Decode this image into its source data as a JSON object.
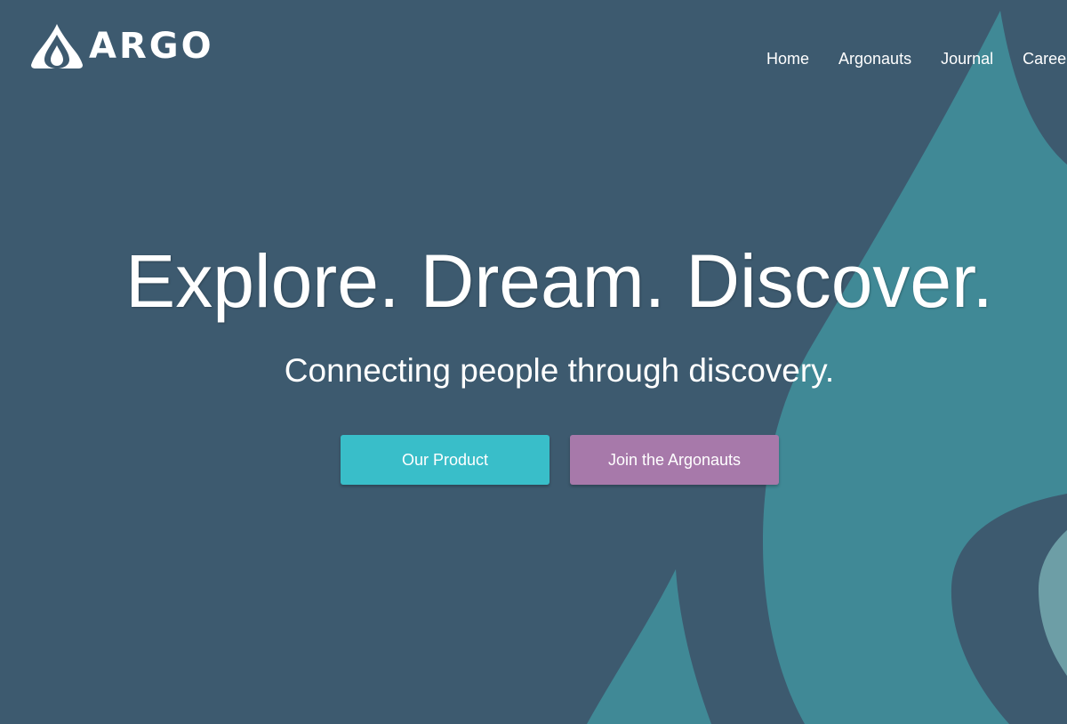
{
  "brand": {
    "name": "ARGO",
    "logo_icon": "water-drop-icon"
  },
  "nav": {
    "items": [
      "Home",
      "Argonauts",
      "Journal",
      "Careers"
    ]
  },
  "hero": {
    "headline": "Explore. Dream. Discover.",
    "subheadline": "Connecting people through discovery.",
    "primary_button": "Our Product",
    "secondary_button": "Join the Argonauts"
  },
  "colors": {
    "background": "#3d5a6f",
    "drop_teal": "#408996",
    "drop_light": "#6d9ea6",
    "primary_button": "#39bec9",
    "secondary_button": "#a779aa",
    "text": "#ffffff"
  }
}
